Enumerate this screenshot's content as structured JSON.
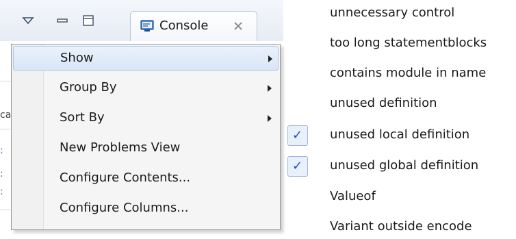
{
  "view_header": {
    "console_tab_label": "Console"
  },
  "background_fragments": [
    {
      "text": "ca",
      "style": "gray"
    },
    {
      "text": ":",
      "style": "blue"
    },
    {
      "text": ":",
      "style": "blue"
    },
    {
      "text": ":",
      "style": "blue"
    }
  ],
  "menu": {
    "items": [
      {
        "label": "Show",
        "has_submenu": true,
        "highlighted": true
      },
      {
        "label": "Group By",
        "has_submenu": true,
        "highlighted": false
      },
      {
        "label": "Sort By",
        "has_submenu": true,
        "highlighted": false
      },
      {
        "label": "New Problems View",
        "has_submenu": false,
        "highlighted": false
      },
      {
        "label": "Configure Contents...",
        "has_submenu": false,
        "highlighted": false
      },
      {
        "label": "Configure Columns...",
        "has_submenu": false,
        "highlighted": false
      }
    ]
  },
  "show_submenu": {
    "items": [
      {
        "label": "unnecessary control",
        "checked": false
      },
      {
        "label": "too long statementblocks",
        "checked": false
      },
      {
        "label": "contains module in name",
        "checked": false
      },
      {
        "label": "unused definition",
        "checked": false
      },
      {
        "label": "unused local definition",
        "checked": true
      },
      {
        "label": "unused global definition",
        "checked": true
      },
      {
        "label": "Valueof",
        "checked": false
      },
      {
        "label": "Variant outside encode",
        "checked": false
      }
    ]
  },
  "colors": {
    "highlight_border": "#a9c3e6",
    "check_color": "#1f4fb5",
    "menu_background": "#f5f5f5"
  }
}
